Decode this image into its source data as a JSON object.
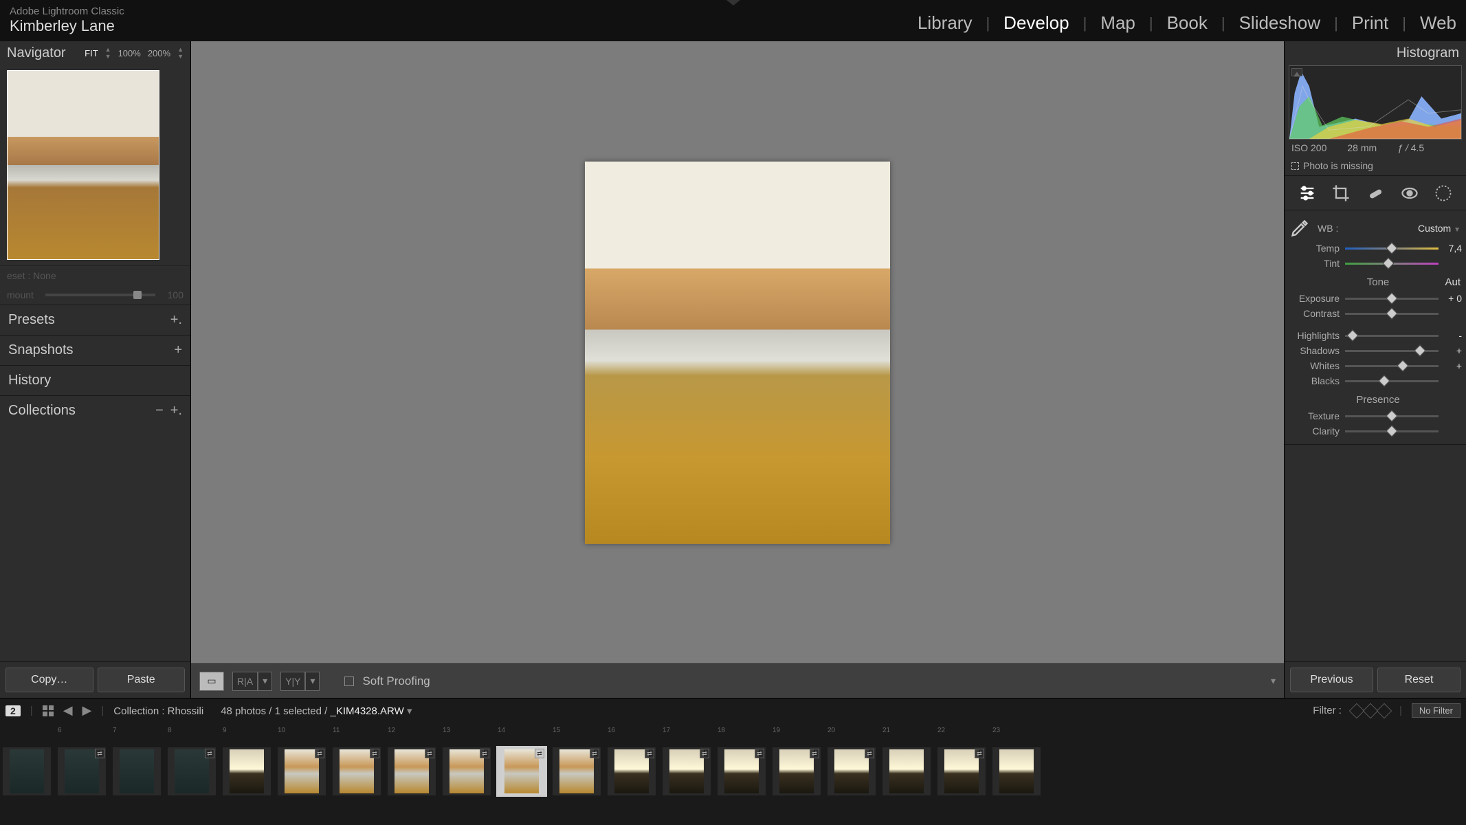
{
  "app": {
    "title": "Adobe Lightroom Classic",
    "user": "Kimberley Lane"
  },
  "modules": {
    "items": [
      "Library",
      "Develop",
      "Map",
      "Book",
      "Slideshow",
      "Print",
      "Web"
    ],
    "active": "Develop"
  },
  "navigator": {
    "title": "Navigator",
    "zoom_fit": "FIT",
    "zoom_100": "100%",
    "zoom_200": "200%"
  },
  "preset_row": "eset : None",
  "amount_row": {
    "label": "mount",
    "value": "100"
  },
  "left_sections": {
    "presets": "Presets",
    "snapshots": "Snapshots",
    "history": "History",
    "collections": "Collections"
  },
  "left_buttons": {
    "copy": "Copy…",
    "paste": "Paste"
  },
  "toolbar": {
    "soft_proofing": "Soft Proofing"
  },
  "histogram": {
    "title": "Histogram",
    "iso": "ISO 200",
    "focal": "28 mm",
    "aperture_prefix": "ƒ / ",
    "aperture_val": "4.5",
    "missing": "Photo is missing"
  },
  "basic": {
    "wb_label": "WB :",
    "wb_value": "Custom",
    "temp": {
      "label": "Temp",
      "value": "7,4",
      "pos": 50
    },
    "tint": {
      "label": "Tint",
      "value": "",
      "pos": 46
    },
    "tone_label": "Tone",
    "auto_label": "Aut",
    "exposure": {
      "label": "Exposure",
      "value": "+ 0",
      "pos": 50
    },
    "contrast": {
      "label": "Contrast",
      "value": "",
      "pos": 50
    },
    "highlights": {
      "label": "Highlights",
      "value": "-",
      "pos": 8
    },
    "shadows": {
      "label": "Shadows",
      "value": "+",
      "pos": 80
    },
    "whites": {
      "label": "Whites",
      "value": "+",
      "pos": 62
    },
    "blacks": {
      "label": "Blacks",
      "value": "",
      "pos": 42
    },
    "presence_label": "Presence",
    "texture": {
      "label": "Texture",
      "value": "",
      "pos": 50
    },
    "clarity": {
      "label": "Clarity",
      "value": "",
      "pos": 50
    }
  },
  "right_buttons": {
    "previous": "Previous",
    "reset": "Reset"
  },
  "filmstrip_header": {
    "second_badge": "2",
    "collection_label": "Collection : Rhossili",
    "count_text": "48 photos / 1 selected /",
    "filename": "_KIM4328.ARW",
    "filter_label": "Filter :",
    "no_filter": "No Filter"
  },
  "filmstrip": {
    "items": [
      {
        "n": "",
        "type": "dark",
        "badged": false
      },
      {
        "n": "6",
        "type": "dark",
        "badged": true
      },
      {
        "n": "7",
        "type": "dark",
        "badged": false
      },
      {
        "n": "8",
        "type": "dark",
        "badged": true
      },
      {
        "n": "9",
        "type": "sunset",
        "badged": false
      },
      {
        "n": "10",
        "type": "beach",
        "badged": true
      },
      {
        "n": "11",
        "type": "beach",
        "badged": true
      },
      {
        "n": "12",
        "type": "beach",
        "badged": true
      },
      {
        "n": "13",
        "type": "beach",
        "badged": true
      },
      {
        "n": "14",
        "type": "beach",
        "badged": true,
        "selected": true
      },
      {
        "n": "15",
        "type": "beach",
        "badged": true
      },
      {
        "n": "16",
        "type": "sunset",
        "badged": true
      },
      {
        "n": "17",
        "type": "sunset",
        "badged": true
      },
      {
        "n": "18",
        "type": "sunset",
        "badged": true
      },
      {
        "n": "19",
        "type": "sunset",
        "badged": true
      },
      {
        "n": "20",
        "type": "sunset",
        "badged": true
      },
      {
        "n": "21",
        "type": "sunset",
        "badged": false
      },
      {
        "n": "22",
        "type": "sunset",
        "badged": true
      },
      {
        "n": "23",
        "type": "sunset",
        "badged": false
      }
    ]
  },
  "chart_data": {
    "type": "area",
    "title": "Histogram",
    "xlabel": "",
    "ylabel": "",
    "x_range": [
      0,
      255
    ],
    "series": [
      {
        "name": "blue",
        "peak_x": 20,
        "peak_y": 95,
        "spread": 18
      },
      {
        "name": "cyan",
        "peak_x": 28,
        "peak_y": 60,
        "spread": 22
      },
      {
        "name": "green",
        "peak_x": 80,
        "peak_y": 30,
        "spread": 70
      },
      {
        "name": "yellow",
        "peak_x": 110,
        "peak_y": 28,
        "spread": 70
      },
      {
        "name": "red",
        "peak_x": 170,
        "peak_y": 25,
        "spread": 60
      },
      {
        "name": "luma",
        "peak_x": 200,
        "peak_y": 55,
        "spread": 30
      }
    ]
  }
}
